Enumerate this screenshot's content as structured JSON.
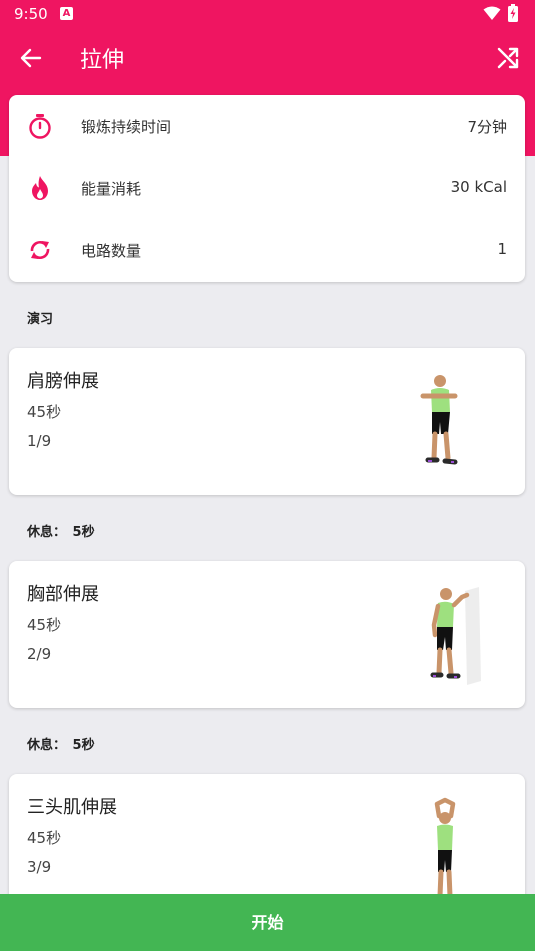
{
  "status": {
    "time": "9:50",
    "notification_letter": "A"
  },
  "header": {
    "title": "拉伸"
  },
  "info": [
    {
      "icon": "stopwatch-icon",
      "label": "锻炼持续时间",
      "value": "7分钟"
    },
    {
      "icon": "flame-icon",
      "label": "能量消耗",
      "value": "30 kCal"
    },
    {
      "icon": "repeat-icon",
      "label": "电路数量",
      "value": "1"
    }
  ],
  "section_title": "演习",
  "exercises": [
    {
      "name": "肩膀伸展",
      "duration": "45秒",
      "index": "1/9"
    },
    {
      "name": "胸部伸展",
      "duration": "45秒",
      "index": "2/9"
    },
    {
      "name": "三头肌伸展",
      "duration": "45秒",
      "index": "3/9"
    }
  ],
  "rests": [
    {
      "label": "休息：",
      "value": "5秒"
    },
    {
      "label": "休息：",
      "value": "5秒"
    }
  ],
  "start_button": "开始",
  "colors": {
    "accent": "#ef1561",
    "start": "#43b653",
    "shirt": "#9ee07f"
  }
}
